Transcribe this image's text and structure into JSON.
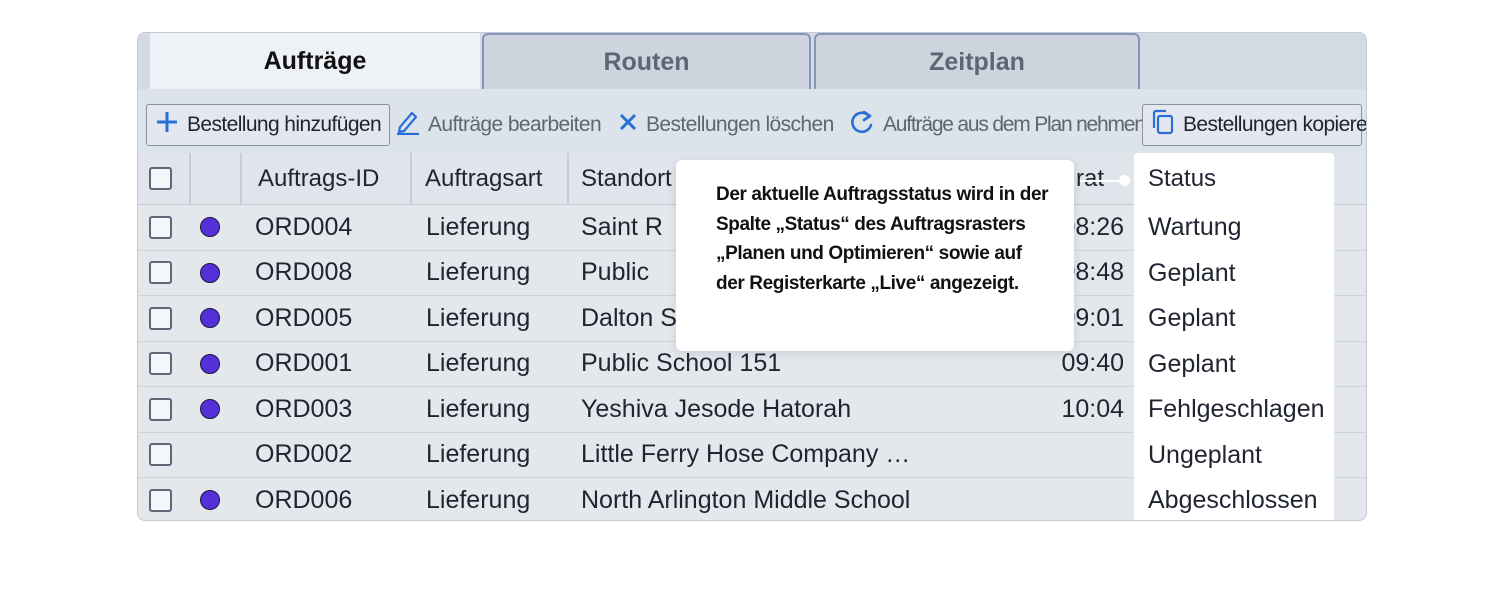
{
  "tabs": [
    {
      "label": "Aufträge",
      "active": true
    },
    {
      "label": "Routen",
      "active": false
    },
    {
      "label": "Zeitplan",
      "active": false
    }
  ],
  "toolbar": {
    "add": {
      "label": "Bestellung hinzufügen",
      "icon": "plus-icon"
    },
    "edit": {
      "label": "Aufträge bearbeiten",
      "icon": "pencil-icon"
    },
    "delete": {
      "label": "Bestellungen löschen",
      "icon": "close-icon"
    },
    "unplan": {
      "label": "Aufträge aus dem Plan nehmen",
      "icon": "undo-icon"
    },
    "copy": {
      "label": "Bestellungen kopieren",
      "icon": "copy-icon"
    }
  },
  "columns": {
    "id": "Auftrags-ID",
    "type": "Auftragsart",
    "location": "Standort",
    "time_partial": "rat",
    "status": "Status"
  },
  "rows": [
    {
      "id": "ORD004",
      "type": "Lieferung",
      "location": "Saint R",
      "time": "08:26",
      "status": "Wartung",
      "marker": true
    },
    {
      "id": "ORD008",
      "type": "Lieferung",
      "location": "Public",
      "time": "08:48",
      "status": "Geplant",
      "marker": true
    },
    {
      "id": "ORD005",
      "type": "Lieferung",
      "location": "Dalton S",
      "time": "09:01",
      "status": "Geplant",
      "marker": true
    },
    {
      "id": "ORD001",
      "type": "Lieferung",
      "location": "Public School 151",
      "time": "09:40",
      "status": "Geplant",
      "marker": true
    },
    {
      "id": "ORD003",
      "type": "Lieferung",
      "location": "Yeshiva Jesode Hatorah",
      "time": "10:04",
      "status": "Fehlgeschlagen",
      "marker": true
    },
    {
      "id": "ORD002",
      "type": "Lieferung",
      "location": "Little Ferry Hose Company …",
      "time": "",
      "status": "Ungeplant",
      "marker": false
    },
    {
      "id": "ORD006",
      "type": "Lieferung",
      "location": "North Arlington Middle School",
      "time": "",
      "status": "Abgeschlossen",
      "marker": true
    }
  ],
  "tooltip": {
    "text": "Der aktuelle Auftragsstatus wird in der Spalte „Status“ des Auftragsrasters „Planen und Optimieren“ sowie auf der Registerkarte „Live“ angezeigt."
  },
  "colors": {
    "accent": "#2a6fd6",
    "marker": "#5530d8"
  }
}
